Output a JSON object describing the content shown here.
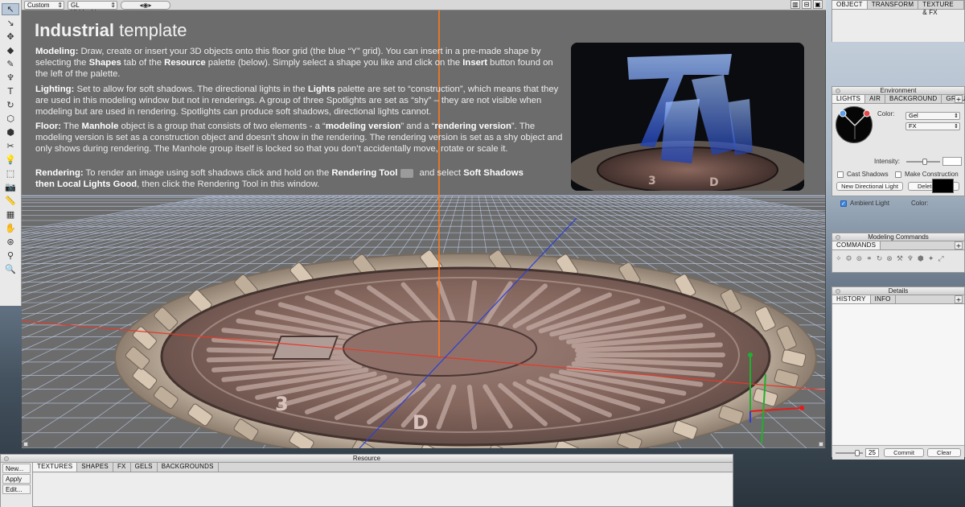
{
  "toolbar": {
    "tools": [
      {
        "name": "select-tool",
        "glyph": "↖"
      },
      {
        "name": "subselect-tool",
        "glyph": "↘"
      },
      {
        "name": "move-tool",
        "glyph": "✥"
      },
      {
        "name": "shape-tool",
        "glyph": "◆"
      },
      {
        "name": "paint-tool",
        "glyph": "✎"
      },
      {
        "name": "pen-tool",
        "glyph": "♆"
      },
      {
        "name": "text-tool",
        "glyph": "T"
      },
      {
        "name": "rotate-tool",
        "glyph": "↻"
      },
      {
        "name": "scale-tool",
        "glyph": "⬡"
      },
      {
        "name": "cube-tool",
        "glyph": "⬢"
      },
      {
        "name": "knife-tool",
        "glyph": "✂"
      },
      {
        "name": "light-tool",
        "glyph": "💡"
      },
      {
        "name": "render-area-tool",
        "glyph": "⬚"
      },
      {
        "name": "camera-tool",
        "glyph": "📷"
      },
      {
        "name": "measure-tool",
        "glyph": "📏"
      },
      {
        "name": "grid-tool",
        "glyph": "▦"
      },
      {
        "name": "hand-tool",
        "glyph": "✋"
      },
      {
        "name": "dolly-tool",
        "glyph": "⊛"
      },
      {
        "name": "walk-tool",
        "glyph": "⚲"
      },
      {
        "name": "zoom-tool",
        "glyph": "🔍"
      }
    ]
  },
  "topbar": {
    "view_mode": "Custom",
    "render_mode": "GL HiddenLine",
    "nav_glyph": "◂◉▸",
    "view_buttons": [
      "▥",
      "⊟",
      "▣"
    ]
  },
  "template": {
    "title_bold": "Industrial",
    "title_rest": " template",
    "modeling": {
      "heading": "Modeling:",
      "t1": " Draw, create or insert your 3D objects onto this floor grid (the blue “Y” grid). You can insert in a pre-made shape by selecting the ",
      "b1": "Shapes",
      "t2": " tab of the ",
      "b2": "Resource",
      "t3": " palette (below). Simply select a shape you like and click on the ",
      "b3": "Insert",
      "t4": " button found on the left of the palette."
    },
    "lighting": {
      "heading": "Lighting:",
      "t1": " Set to allow for soft shadows. The directional lights in the ",
      "b1": "Lights",
      "t2": " palette are set to “construction”, which means that they are used in this modeling window but not in renderings. A group of three Spotlights are set as “shy” – they are not visible when modeling but are used in rendering. Spotlights can produce soft shadows, directional lights cannot."
    },
    "floor": {
      "heading": "Floor:",
      "t1": " The ",
      "b1": "Manhole",
      "t2": " object is a group that consists of two elements - a “",
      "b2": "modeling version",
      "t3": "” and a “",
      "b3": "rendering version",
      "t4": "”. The modeling version is set as a construction object and doesn’t show in the rendering. The rendering version is set as a shy object and only shows during rendering. The Manhole group itself is locked so that you don’t accidentally move, rotate or scale it."
    },
    "rendering": {
      "heading": "Rendering:",
      "t1": " To render an image using soft shadows click and hold on the ",
      "b1": "Rendering Tool",
      "t2": " and select ",
      "b2": "Soft Shadows",
      "b3": "then Local Lights Good",
      "t3": ", then click the Rendering Tool in this window."
    }
  },
  "scene": {
    "manhole_letters": [
      "3",
      "D"
    ],
    "thumb_letters": [
      "3",
      "D"
    ]
  },
  "object_palette": {
    "tabs": [
      "OBJECT",
      "TRANSFORM",
      "TEXTURE & FX"
    ]
  },
  "environment": {
    "title": "Environment",
    "tabs": [
      "LIGHTS",
      "AIR",
      "BACKGROUND",
      "GROUND"
    ],
    "color_label": "Color:",
    "gel_value": "Gel",
    "fx_value": "FX",
    "intensity_label": "Intensity:",
    "intensity_level": 0.55,
    "cast_shadows_label": "Cast Shadows",
    "make_construction_label": "Make Construction",
    "new_light_label": "New Directional Light",
    "delete_light_label": "Delete Light",
    "ambient_label": "Ambient Light",
    "ambient_color_label": "Color:",
    "ambient_color": "#000000",
    "ambient_checked": true
  },
  "modeling_commands": {
    "title": "Modeling Commands",
    "tabs": [
      "COMMANDS"
    ],
    "icons": [
      "✧",
      "⚙",
      "⊚",
      "⚭",
      "↻",
      "⊗",
      "⚒",
      "♆",
      "⬢",
      "✦",
      "⤢"
    ]
  },
  "details": {
    "title": "Details",
    "tabs": [
      "HISTORY",
      "INFO"
    ],
    "history_count": "25",
    "commit_label": "Commit",
    "clear_label": "Clear"
  },
  "resource": {
    "title": "Resource",
    "buttons": [
      "New...",
      "Apply",
      "Edit..."
    ],
    "tabs": [
      "TEXTURES",
      "SHAPES",
      "FX",
      "GELS",
      "BACKGROUNDS"
    ]
  },
  "colors": {
    "grid_line": "#c4d4f2",
    "axis_x": "#e23a2a",
    "axis_y": "#2a3fd8",
    "axis_z": "#ff7a1a",
    "accent_tab": "#f4f4f4"
  }
}
